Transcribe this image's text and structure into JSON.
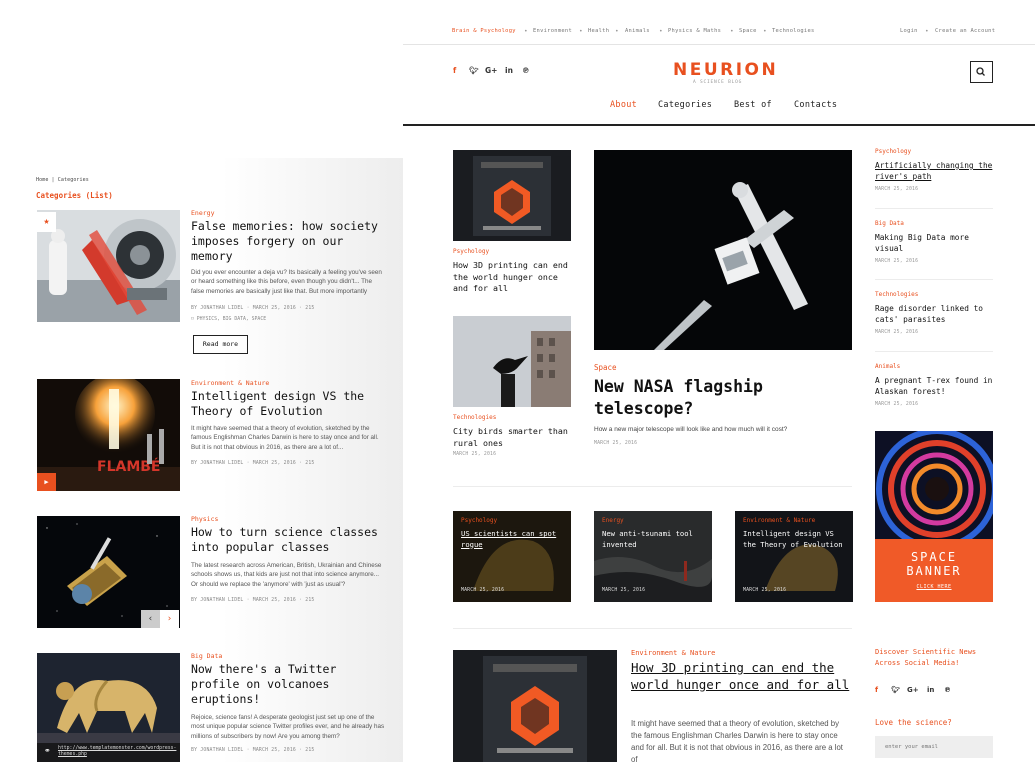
{
  "left": {
    "breadcrumb": "Home | Categories",
    "page_title": "Categories (List)",
    "posts": [
      {
        "category": "Energy",
        "title": "False memories: how society imposes forgery on our memory",
        "excerpt": "Did you ever encounter a deja vu? Its basically a feeling you've seen or heard something like this before, even though you didn't... The false memories are basically just like that. But more importantly",
        "meta": "BY JONATHAN LIDEL  ·  MARCH 25, 2016  ·  215",
        "tags": "PHYSICS, BIG DATA, SPACE",
        "read_more": "Read more"
      },
      {
        "category": "Environment & Nature",
        "title": "Intelligent design VS the Theory of Evolution",
        "excerpt": "It might have seemed that a theory of evolution, sketched by the famous Englishman Charles Darwin is here to stay once and for all. But it is not that obvious in 2016, as there are a lot of...",
        "meta": "BY JONATHAN LIDEL  ·  MARCH 25, 2016  ·  215"
      },
      {
        "category": "Physics",
        "title": "How to turn science classes into popular classes",
        "excerpt": "The latest research across American, British, Ukrainian and Chinese schools shows us, that kids are just not that into science anymore... Or should we replace the 'anymore' with 'just as usual'?",
        "meta": "BY JONATHAN LIDEL  ·  MARCH 25, 2016  ·  215"
      },
      {
        "category": "Big Data",
        "title": "Now there's a Twitter profile on volcanoes eruptions!",
        "excerpt": "Rejoice, science fans! A desperate geologist just set up one of the most unique popular science Twitter profiles ever, and he already has millions of subscribers by now! Are you among them?",
        "meta": "BY JONATHAN LIDEL  ·  MARCH 25, 2016  ·  215",
        "link": "http://www.templatemonster.com/wordpress-themes.php"
      }
    ]
  },
  "top_nav": [
    "Brain & Psychology",
    "Environment",
    "Health",
    "Animals",
    "Physics & Maths",
    "Space",
    "Technologies"
  ],
  "auth": {
    "login": "Login",
    "create": "Create an Account"
  },
  "brand": {
    "logo": "NEURION",
    "tagline": "A SCIENCE BLOG"
  },
  "social_icons": [
    "f",
    "t",
    "G+",
    "in",
    "p"
  ],
  "main_nav": [
    "About",
    "Categories",
    "Best of",
    "Contacts"
  ],
  "grid": {
    "small1": {
      "category": "Psychology",
      "title": "How 3D printing can end the world hunger once and for all"
    },
    "small2": {
      "category": "Technologies",
      "title": "City birds smarter than rural ones",
      "date": "MARCH 25, 2016"
    },
    "feature": {
      "category": "Space",
      "title": "New NASA flagship telescope?",
      "excerpt": "How a new major telescope will look like and how much will it cost?",
      "date": "MARCH 25, 2016"
    }
  },
  "sidebar_posts": [
    {
      "category": "Psychology",
      "title": "Artificially changing the river's path",
      "date": "MARCH 25, 2016"
    },
    {
      "category": "Big Data",
      "title": "Making Big Data more visual",
      "date": "MARCH 25, 2016"
    },
    {
      "category": "Technologies",
      "title": "Rage disorder linked to cats' parasites",
      "date": "MARCH 25, 2016"
    },
    {
      "category": "Animals",
      "title": "A pregnant T-rex found in Alaskan forest!",
      "date": "MARCH 25, 2016"
    }
  ],
  "dark_cards": [
    {
      "category": "Psychology",
      "title": "US scientists can spot rogue",
      "date": "MARCH 25, 2016"
    },
    {
      "category": "Energy",
      "title": "New anti-tsunami tool invented",
      "date": "MARCH 25, 2016"
    },
    {
      "category": "Environment & Nature",
      "title": "Intelligent design VS the Theory of Evolution",
      "date": "MARCH 25, 2016"
    }
  ],
  "banner": {
    "line1": "SPACE",
    "line2": "BANNER",
    "cta": "CLICK HERE"
  },
  "bottom_post": {
    "category": "Environment & Nature",
    "title": "How 3D printing can end the world hunger once and for all",
    "excerpt": "It might have seemed that a theory of evolution, sketched by the famous Englishman Charles Darwin is here to stay once and for all. But it is not that obvious in 2016, as there are a lot of"
  },
  "discover": "Discover Scientific News Across Social Media!",
  "newsletter": {
    "heading": "Love the science?",
    "placeholder": "enter your email"
  },
  "colors": {
    "accent": "#e8501f",
    "banner": "#f05a28"
  }
}
